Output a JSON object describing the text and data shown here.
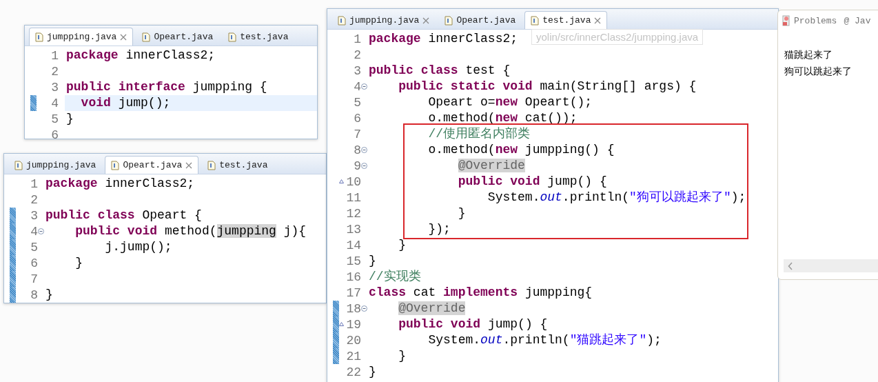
{
  "editors": [
    {
      "highlight_frame": false,
      "tabs": [
        {
          "label": "jumpping.java",
          "selected": true,
          "close_icon": true
        },
        {
          "label": "Opeart.java",
          "selected": false,
          "close_icon": false
        },
        {
          "label": "test.java",
          "selected": false,
          "close_icon": false
        }
      ],
      "lines": [
        {
          "number": "1",
          "changed": false,
          "fold": false,
          "override": false,
          "current": false,
          "tokens": [
            {
              "kind": "kw",
              "t": "package"
            },
            {
              "kind": "id",
              "t": " innerClass2;"
            }
          ]
        },
        {
          "number": "2",
          "changed": false,
          "fold": false,
          "override": false,
          "current": false
        },
        {
          "number": "3",
          "changed": false,
          "fold": false,
          "override": false,
          "current": false,
          "tokens": [
            {
              "kind": "kw",
              "t": "public"
            },
            {
              "kind": "kw",
              "t": " interface"
            },
            {
              "kind": "id",
              "t": " jumpping {"
            }
          ]
        },
        {
          "number": "4",
          "changed": true,
          "fold": false,
          "override": false,
          "current": true,
          "tokens": [
            {
              "kind": "kw",
              "t": "  void"
            },
            {
              "kind": "id",
              "t": " jump();"
            }
          ]
        },
        {
          "number": "5",
          "changed": false,
          "fold": false,
          "override": false,
          "current": false,
          "tokens": [
            {
              "kind": "id",
              "t": "}"
            }
          ]
        },
        {
          "number": "6",
          "changed": false,
          "fold": false,
          "override": false,
          "current": false
        }
      ]
    },
    {
      "highlight_frame": false,
      "tabs": [
        {
          "label": "jumpping.java",
          "selected": false,
          "close_icon": false
        },
        {
          "label": "Opeart.java",
          "selected": true,
          "close_icon": true
        },
        {
          "label": "test.java",
          "selected": false,
          "close_icon": false
        }
      ],
      "lines": [
        {
          "number": "1",
          "changed": false,
          "fold": false,
          "override": false,
          "tokens": [
            {
              "kind": "kw",
              "t": "package"
            },
            {
              "kind": "id",
              "t": " innerClass2;"
            }
          ]
        },
        {
          "number": "2",
          "changed": false,
          "fold": false,
          "override": false
        },
        {
          "number": "3",
          "changed": true,
          "fold": false,
          "override": false,
          "tokens": [
            {
              "kind": "kw",
              "t": "public"
            },
            {
              "kind": "kw",
              "t": " class"
            },
            {
              "kind": "id",
              "t": " Opeart {"
            }
          ]
        },
        {
          "number": "4",
          "changed": true,
          "fold": true,
          "override": false,
          "tokens": [
            {
              "kind": "kw",
              "t": "    public"
            },
            {
              "kind": "kw",
              "t": " void"
            },
            {
              "kind": "id",
              "t": " method("
            },
            {
              "kind": "occ",
              "t": "jumpping"
            },
            {
              "kind": "id",
              "t": " j){"
            }
          ]
        },
        {
          "number": "5",
          "changed": true,
          "fold": false,
          "override": false,
          "tokens": [
            {
              "kind": "id",
              "t": "        j.jump();"
            }
          ]
        },
        {
          "number": "6",
          "changed": true,
          "fold": false,
          "override": false,
          "tokens": [
            {
              "kind": "id",
              "t": "    }"
            }
          ]
        },
        {
          "number": "7",
          "changed": true,
          "fold": false,
          "override": false
        },
        {
          "number": "8",
          "changed": true,
          "fold": false,
          "override": false,
          "tokens": [
            {
              "kind": "id",
              "t": "}"
            }
          ]
        }
      ]
    },
    {
      "highlight_frame": true,
      "tabs": [
        {
          "label": "jumpping.java",
          "selected": false,
          "close_icon": true
        },
        {
          "label": "Opeart.java",
          "selected": false,
          "close_icon": false
        },
        {
          "label": "test.java",
          "selected": true,
          "close_icon": true
        }
      ],
      "tooltip": {
        "text": "yolin/src/innerClass2/jumpping.java"
      },
      "lines": [
        {
          "number": "1",
          "changed": false,
          "fold": false,
          "override": false,
          "tokens": [
            {
              "kind": "kw",
              "t": "package"
            },
            {
              "kind": "id",
              "t": " innerClass2;"
            }
          ]
        },
        {
          "number": "2",
          "changed": false,
          "fold": false,
          "override": false
        },
        {
          "number": "3",
          "changed": false,
          "fold": false,
          "override": false,
          "tokens": [
            {
              "kind": "kw",
              "t": "public"
            },
            {
              "kind": "kw",
              "t": " class"
            },
            {
              "kind": "id",
              "t": " test {"
            }
          ]
        },
        {
          "number": "4",
          "changed": false,
          "fold": true,
          "override": false,
          "tokens": [
            {
              "kind": "kw",
              "t": "    public"
            },
            {
              "kind": "kw",
              "t": " static"
            },
            {
              "kind": "kw",
              "t": " void"
            },
            {
              "kind": "id",
              "t": " main(String[] args) {"
            }
          ]
        },
        {
          "number": "5",
          "changed": false,
          "fold": false,
          "override": false,
          "tokens": [
            {
              "kind": "id",
              "t": "        Opeart o="
            },
            {
              "kind": "kw",
              "t": "new"
            },
            {
              "kind": "id",
              "t": " Opeart();"
            }
          ]
        },
        {
          "number": "6",
          "changed": false,
          "fold": false,
          "override": false,
          "tokens": [
            {
              "kind": "id",
              "t": "        o.method("
            },
            {
              "kind": "kw",
              "t": "new"
            },
            {
              "kind": "id",
              "t": " cat());"
            }
          ]
        },
        {
          "number": "7",
          "changed": false,
          "fold": false,
          "override": false,
          "tokens": [
            {
              "kind": "comment",
              "t": "        //使用匿名内部类"
            }
          ]
        },
        {
          "number": "8",
          "changed": false,
          "fold": true,
          "override": false,
          "tokens": [
            {
              "kind": "id",
              "t": "        o.method("
            },
            {
              "kind": "kw",
              "t": "new"
            },
            {
              "kind": "id",
              "t": " jumpping() {"
            }
          ]
        },
        {
          "number": "9",
          "changed": false,
          "fold": true,
          "override": false,
          "tokens": [
            {
              "kind": "occ-ann",
              "t": "            @Override"
            }
          ]
        },
        {
          "number": "10",
          "changed": false,
          "fold": false,
          "override": true,
          "tokens": [
            {
              "kind": "kw",
              "t": "            public"
            },
            {
              "kind": "kw",
              "t": " void"
            },
            {
              "kind": "id",
              "t": " jump() {"
            }
          ]
        },
        {
          "number": "11",
          "changed": false,
          "fold": false,
          "override": false,
          "tokens": [
            {
              "kind": "id",
              "t": "                System."
            },
            {
              "kind": "field",
              "t": "out"
            },
            {
              "kind": "id",
              "t": ".println("
            },
            {
              "kind": "str",
              "t": "\"狗可以跳起来了\""
            },
            {
              "kind": "id",
              "t": ");"
            }
          ]
        },
        {
          "number": "12",
          "changed": false,
          "fold": false,
          "override": false,
          "tokens": [
            {
              "kind": "id",
              "t": "            }"
            }
          ]
        },
        {
          "number": "13",
          "changed": false,
          "fold": false,
          "override": false,
          "tokens": [
            {
              "kind": "id",
              "t": "        });"
            }
          ]
        },
        {
          "number": "14",
          "changed": false,
          "fold": false,
          "override": false,
          "tokens": [
            {
              "kind": "id",
              "t": "    }"
            }
          ]
        },
        {
          "number": "15",
          "changed": false,
          "fold": false,
          "override": false,
          "tokens": [
            {
              "kind": "id",
              "t": "}"
            }
          ]
        },
        {
          "number": "16",
          "changed": false,
          "fold": false,
          "override": false,
          "tokens": [
            {
              "kind": "comment",
              "t": "//实现类"
            }
          ]
        },
        {
          "number": "17",
          "changed": false,
          "fold": false,
          "override": false,
          "tokens": [
            {
              "kind": "kw",
              "t": "class"
            },
            {
              "kind": "id",
              "t": " cat "
            },
            {
              "kind": "kw",
              "t": "implements"
            },
            {
              "kind": "id",
              "t": " jumpping{"
            }
          ]
        },
        {
          "number": "18",
          "changed": true,
          "fold": true,
          "override": false,
          "tokens": [
            {
              "kind": "occ-ann",
              "t": "    @Override"
            }
          ]
        },
        {
          "number": "19",
          "changed": true,
          "fold": false,
          "override": true,
          "tokens": [
            {
              "kind": "kw",
              "t": "    public"
            },
            {
              "kind": "kw",
              "t": " void"
            },
            {
              "kind": "id",
              "t": " jump() {"
            }
          ]
        },
        {
          "number": "20",
          "changed": true,
          "fold": false,
          "override": false,
          "tokens": [
            {
              "kind": "id",
              "t": "        System."
            },
            {
              "kind": "field",
              "t": "out"
            },
            {
              "kind": "id",
              "t": ".println("
            },
            {
              "kind": "str",
              "t": "\"猫跳起来了\""
            },
            {
              "kind": "id",
              "t": ");"
            }
          ]
        },
        {
          "number": "21",
          "changed": true,
          "fold": false,
          "override": false,
          "tokens": [
            {
              "kind": "id",
              "t": "    }"
            }
          ]
        },
        {
          "number": "22",
          "changed": false,
          "fold": false,
          "override": false,
          "tokens": [
            {
              "kind": "id",
              "t": "}"
            }
          ]
        }
      ]
    }
  ],
  "console": {
    "tabs": [
      {
        "kind": "problems",
        "label": "Problems"
      },
      {
        "kind": "javadoc",
        "label": "@ Jav"
      }
    ],
    "output": [
      "猫跳起来了",
      "狗可以跳起来了"
    ]
  }
}
